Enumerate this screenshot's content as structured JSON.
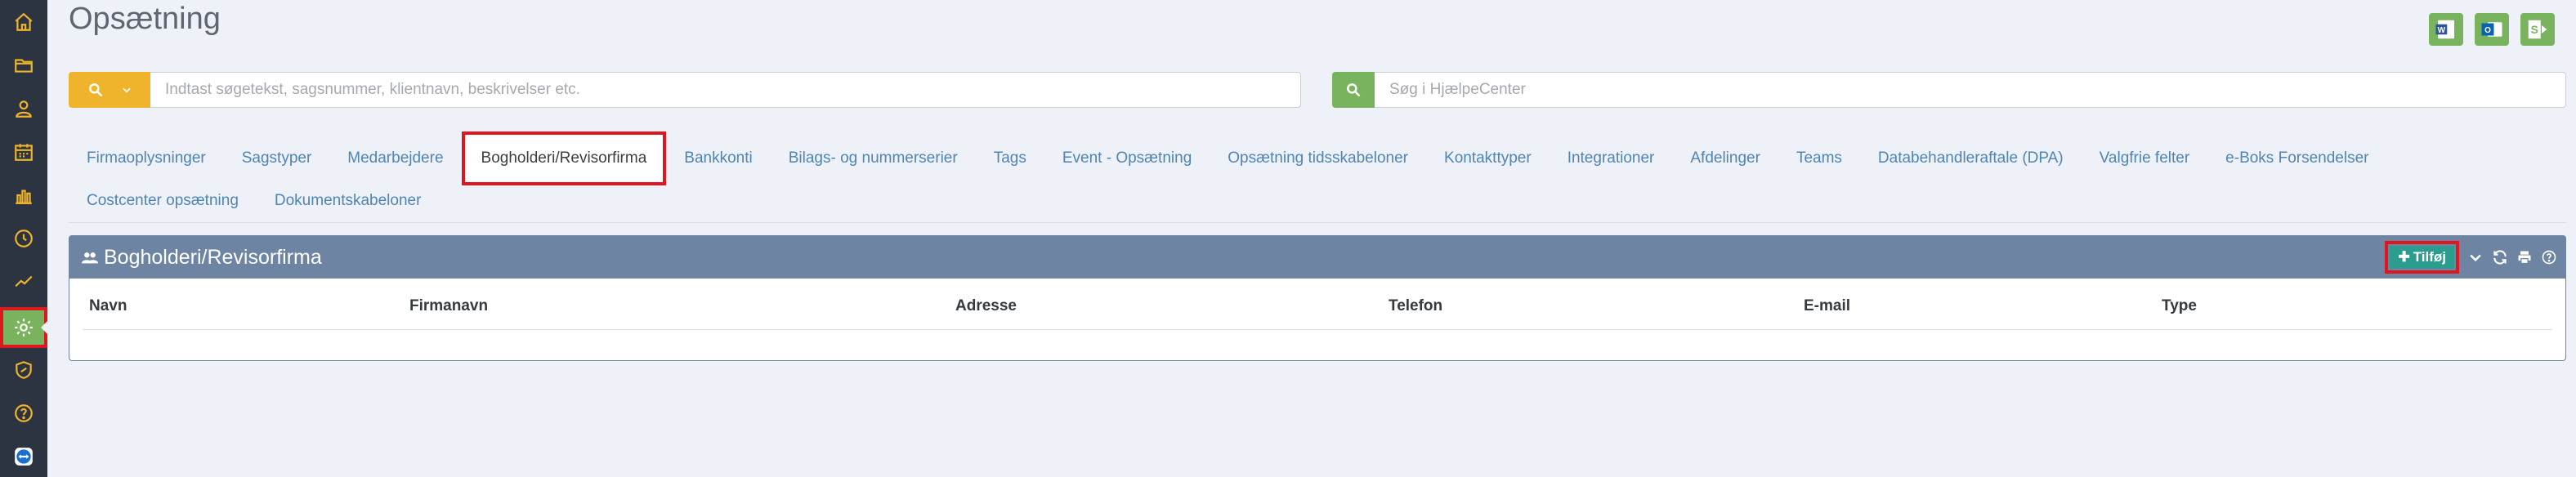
{
  "page": {
    "title": "Opsætning"
  },
  "sidebar": {
    "items": [
      {
        "icon": "home-icon"
      },
      {
        "icon": "folder-icon"
      },
      {
        "icon": "user-icon"
      },
      {
        "icon": "calendar-icon"
      },
      {
        "icon": "bar-chart-icon"
      },
      {
        "icon": "clock-icon"
      },
      {
        "icon": "trend-line-icon"
      },
      {
        "icon": "gear-icon",
        "active": true
      },
      {
        "icon": "shield-icon"
      },
      {
        "icon": "help-icon"
      },
      {
        "icon": "teamviewer-icon"
      }
    ],
    "accent_color": "#7ab35e",
    "highlight_color": "#e0161e"
  },
  "office_icons": [
    {
      "name": "word-icon",
      "letter": "W"
    },
    {
      "name": "outlook-icon",
      "letter": "O"
    },
    {
      "name": "sharepoint-icon",
      "letter": "S"
    }
  ],
  "search": {
    "main_placeholder": "Indtast søgetekst, sagsnummer, klientnavn, beskrivelser etc.",
    "help_placeholder": "Søg i HjælpeCenter"
  },
  "tabs": {
    "row1": [
      "Firmaoplysninger",
      "Sagstyper",
      "Medarbejdere",
      "Bogholderi/Revisorfirma",
      "Bankkonti",
      "Bilags- og nummerserier",
      "Tags",
      "Event - Opsætning",
      "Opsætning tidsskabeloner",
      "Kontakttyper",
      "Integrationer",
      "Afdelinger",
      "Teams",
      "Databehandleraftale (DPA)",
      "Valgfrie felter",
      "e-Boks Forsendelser"
    ],
    "row2": [
      "Costcenter opsætning",
      "Dokumentskabeloner"
    ],
    "active": "Bogholderi/Revisorfirma"
  },
  "panel": {
    "title": "Bogholderi/Revisorfirma",
    "add_label": "Tilføj",
    "columns": [
      "Navn",
      "Firmanavn",
      "Adresse",
      "Telefon",
      "E-mail",
      "Type"
    ],
    "header_color": "#6d84a3",
    "add_color": "#2b9d8f"
  }
}
